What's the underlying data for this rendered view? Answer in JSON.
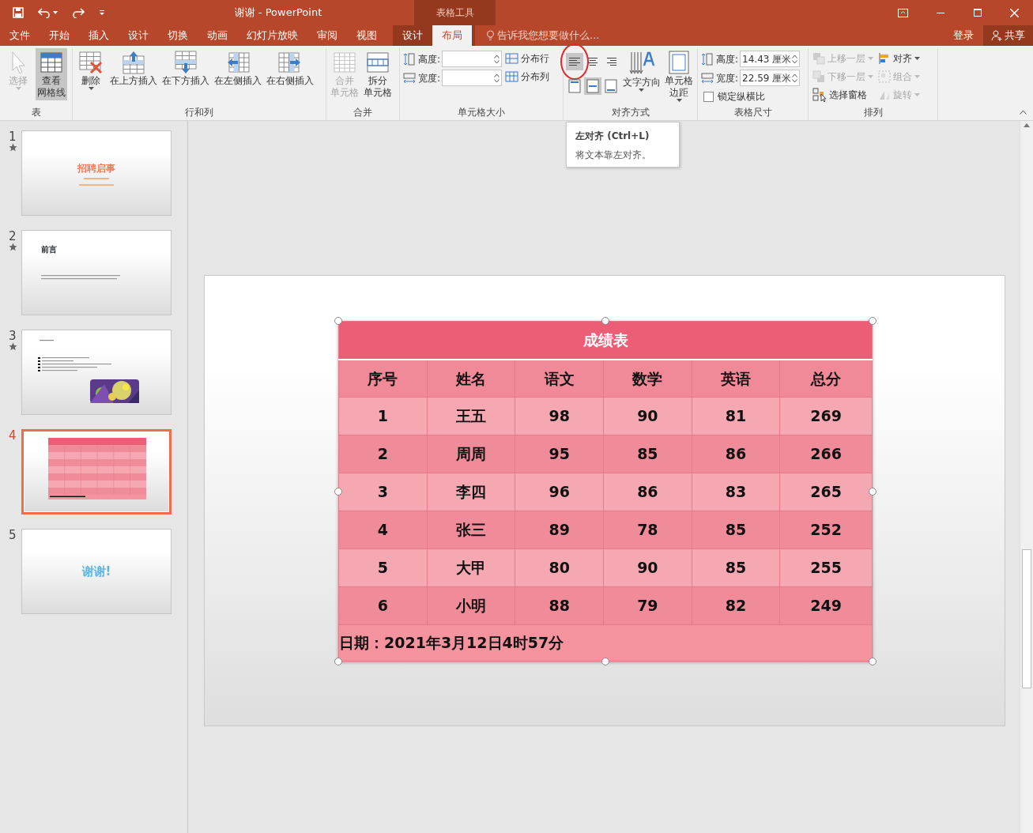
{
  "window": {
    "title": "谢谢 - PowerPoint",
    "context_group": "表格工具"
  },
  "tabs": [
    {
      "label": "文件",
      "selected": false,
      "contextual": false
    },
    {
      "label": "开始",
      "selected": false,
      "contextual": false
    },
    {
      "label": "插入",
      "selected": false,
      "contextual": false
    },
    {
      "label": "设计",
      "selected": false,
      "contextual": false
    },
    {
      "label": "切换",
      "selected": false,
      "contextual": false
    },
    {
      "label": "动画",
      "selected": false,
      "contextual": false
    },
    {
      "label": "幻灯片放映",
      "selected": false,
      "contextual": false
    },
    {
      "label": "审阅",
      "selected": false,
      "contextual": false
    },
    {
      "label": "视图",
      "selected": false,
      "contextual": false
    },
    {
      "label": "设计",
      "selected": false,
      "contextual": true
    },
    {
      "label": "布局",
      "selected": true,
      "contextual": true
    }
  ],
  "tell_me": "告诉我您想要做什么...",
  "account": {
    "sign_in": "登录",
    "share": "共享"
  },
  "ribbon": [
    {
      "label": "表",
      "items": [
        {
          "kind": "large",
          "label": "选择",
          "disabled": true,
          "selected": false,
          "dropdown": true
        },
        {
          "kind": "large",
          "label": "查看网格线",
          "disabled": false,
          "selected": true,
          "dropdown": false
        }
      ]
    },
    {
      "label": "行和列",
      "items": [
        {
          "kind": "large",
          "label": "删除",
          "disabled": false,
          "selected": false,
          "dropdown": true
        },
        {
          "kind": "large",
          "label": "在上方插入",
          "disabled": false,
          "selected": false,
          "dropdown": false
        },
        {
          "kind": "large",
          "label": "在下方插入",
          "disabled": false,
          "selected": false,
          "dropdown": false
        },
        {
          "kind": "large",
          "label": "在左侧插入",
          "disabled": false,
          "selected": false,
          "dropdown": false
        },
        {
          "kind": "large",
          "label": "在右侧插入",
          "disabled": false,
          "selected": false,
          "dropdown": false
        }
      ]
    },
    {
      "label": "合并",
      "items": [
        {
          "kind": "large",
          "label": "合并单元格",
          "disabled": true,
          "selected": false,
          "dropdown": false
        },
        {
          "kind": "large",
          "label": "拆分单元格",
          "disabled": false,
          "selected": false,
          "dropdown": false
        }
      ]
    },
    {
      "label": "单元格大小",
      "items": [
        {
          "kind": "stack",
          "items": [
            {
              "kind": "field",
              "label": "高度:"
            },
            {
              "kind": "field",
              "label": "宽度:"
            }
          ]
        },
        {
          "kind": "stack",
          "items": [
            {
              "kind": "small",
              "label": "分布行",
              "disabled": false,
              "dropdown": false
            },
            {
              "kind": "small",
              "label": "分布列",
              "disabled": false,
              "dropdown": false
            }
          ]
        }
      ]
    },
    {
      "label": "对齐方式",
      "items": [
        {
          "kind": "align_grid",
          "items": [
            {
              "selected": true,
              "annotated": true
            },
            {
              "selected": false,
              "annotated": false
            },
            {
              "selected": false,
              "annotated": false
            },
            {
              "selected": false,
              "annotated": false
            },
            {
              "selected": true,
              "annotated": false
            },
            {
              "selected": false,
              "annotated": false
            }
          ]
        },
        {
          "kind": "large",
          "label": "文字方向",
          "disabled": false,
          "selected": false,
          "dropdown": true
        },
        {
          "kind": "large",
          "label": "单元格边距",
          "disabled": false,
          "selected": false,
          "dropdown": true
        }
      ]
    },
    {
      "label": "表格尺寸",
      "items": [
        {
          "kind": "stack",
          "items": [
            {
              "kind": "field",
              "label": "高度:",
              "value": "14.43 厘米"
            },
            {
              "kind": "field",
              "label": "宽度:",
              "value": "22.59 厘米"
            },
            {
              "kind": "checkbox",
              "label": "锁定纵横比",
              "checked": false
            }
          ]
        }
      ]
    },
    {
      "label": "排列",
      "items": [
        {
          "kind": "stack",
          "items": [
            {
              "kind": "small",
              "label": "上移一层",
              "disabled": true,
              "dropdown": true
            },
            {
              "kind": "small",
              "label": "下移一层",
              "disabled": true,
              "dropdown": true
            },
            {
              "kind": "small",
              "label": "选择窗格",
              "disabled": false,
              "dropdown": false
            }
          ]
        },
        {
          "kind": "stack",
          "items": [
            {
              "kind": "small",
              "label": "对齐",
              "disabled": false,
              "dropdown": true
            },
            {
              "kind": "small",
              "label": "组合",
              "disabled": true,
              "dropdown": true
            },
            {
              "kind": "small",
              "label": "旋转",
              "disabled": true,
              "dropdown": true
            }
          ]
        }
      ]
    }
  ],
  "tooltip": {
    "title": "左对齐 (Ctrl+L)",
    "text": "将文本靠左对齐。"
  },
  "slides": [
    {
      "number": "1",
      "starred": true,
      "selected": false,
      "kind": "title",
      "title": "招聘启事"
    },
    {
      "number": "2",
      "starred": true,
      "selected": false,
      "kind": "heading",
      "title": "前言"
    },
    {
      "number": "3",
      "starred": true,
      "selected": false,
      "kind": "bullets"
    },
    {
      "number": "4",
      "starred": false,
      "selected": true,
      "kind": "table"
    },
    {
      "number": "5",
      "starred": false,
      "selected": false,
      "kind": "closing",
      "title": "谢谢!"
    }
  ],
  "table": {
    "selected": true,
    "title": "成绩表",
    "columns": [
      "序号",
      "姓名",
      "语文",
      "数学",
      "英语",
      "总分"
    ],
    "rows": [
      [
        "1",
        "王五",
        "98",
        "90",
        "81",
        "269"
      ],
      [
        "2",
        "周周",
        "95",
        "85",
        "86",
        "266"
      ],
      [
        "3",
        "李四",
        "96",
        "86",
        "83",
        "265"
      ],
      [
        "4",
        "张三",
        "89",
        "78",
        "85",
        "252"
      ],
      [
        "5",
        "大甲",
        "80",
        "90",
        "85",
        "255"
      ],
      [
        "6",
        "小明",
        "88",
        "79",
        "82",
        "249"
      ]
    ],
    "footer": "日期：2021年3月12日4时57分"
  }
}
